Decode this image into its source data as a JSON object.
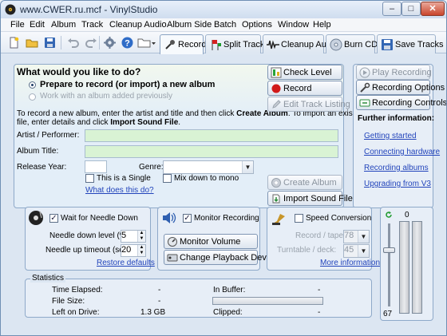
{
  "window": {
    "title": "www.CWER.ru.mcf - VinylStudio"
  },
  "menu": [
    "File",
    "Edit",
    "Album",
    "Track",
    "Cleanup Audio",
    "Album Side",
    "Batch",
    "Options",
    "Window",
    "Help"
  ],
  "tabs": [
    "Record",
    "Split Tracks",
    "Cleanup Audio",
    "Burn CDs",
    "Save Tracks"
  ],
  "main": {
    "heading": "What would you like to do?",
    "radio_prepare": "Prepare to record (or import) a new album",
    "radio_work": "Work with an album added previously",
    "instructions_line1_a": "To record a new album, enter the artist and title and then click ",
    "instructions_line1_b": "Create Album",
    "instructions_line1_c": ".  To import an existing sound",
    "instructions_line2_a": "file, enter details and click ",
    "instructions_line2_b": "Import Sound File",
    "instructions_line2_c": ".",
    "artist_label": "Artist / Performer:",
    "artist_value": "",
    "album_title_label": "Album Title:",
    "album_title_value": "",
    "release_year_label": "Release Year:",
    "release_year_value": "",
    "genre_label": "Genre:",
    "genre_value": "",
    "single_label": "This is a Single",
    "mixdown_label": "Mix down to mono",
    "what_link": "What does this do?",
    "check_level": "Check Level",
    "record": "Record",
    "edit_track_listing": "Edit Track Listing",
    "create_album": "Create Album",
    "import_sound_file": "Import Sound File"
  },
  "right_panel": {
    "play_recording": "Play Recording",
    "recording_options": "Recording Options",
    "recording_controls": "Recording Controls",
    "further_info": "Further information:",
    "links": [
      "Getting started",
      "Connecting hardware",
      "Recording albums",
      "Upgrading from V3"
    ]
  },
  "needle": {
    "wait_label": "Wait for Needle Down",
    "down_level_label": "Needle down level (%):",
    "down_level_value": "5",
    "up_timeout_label": "Needle up timeout (sec):",
    "up_timeout_value": "20",
    "restore_link": "Restore defaults"
  },
  "monitor": {
    "monitor_label": "Monitor Recording",
    "monitor_volume": "Monitor Volume",
    "change_device": "Change Playback Device"
  },
  "speed": {
    "speed_label": "Speed Conversion",
    "record_tape_label": "Record / tape:",
    "record_tape_value": "78",
    "turntable_label": "Turntable / deck:",
    "turntable_value": "45",
    "more_info": "More information"
  },
  "statistics": {
    "title": "Statistics",
    "time_elapsed_label": "Time Elapsed:",
    "time_elapsed_value": "-",
    "file_size_label": "File Size:",
    "file_size_value": "-",
    "left_on_drive_label": "Left on Drive:",
    "left_on_drive_value": "1.3 GB",
    "in_buffer_label": "In Buffer:",
    "in_buffer_value": "-",
    "clipped_label": "Clipped:",
    "clipped_value": "-"
  },
  "levels": {
    "top_value": "0",
    "bottom_value": "67"
  },
  "colors": {
    "accent": "#2244bb",
    "field_green": "#d9f3d4",
    "record_red": "#d11a1a"
  }
}
